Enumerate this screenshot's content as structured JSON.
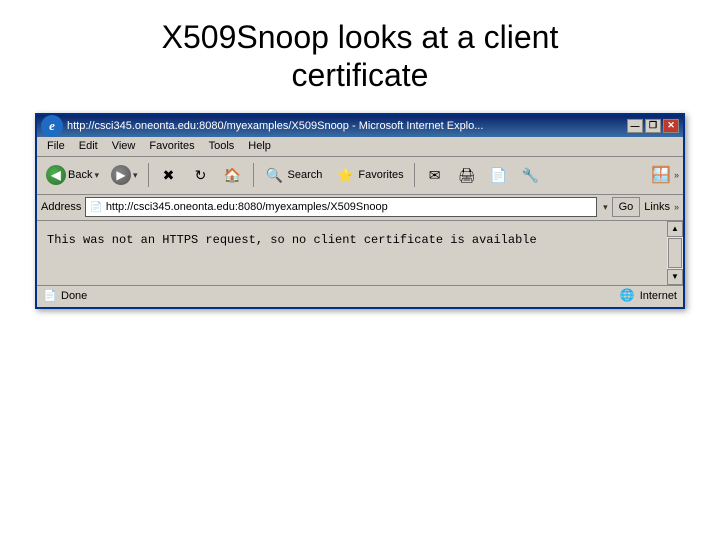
{
  "slide": {
    "title_line1": "X509Snoop looks at a client",
    "title_line2": "certificate"
  },
  "browser": {
    "title_bar": {
      "text": "http://csci345.oneonta.edu:8080/myexamples/X509Snoop - Microsoft Internet Explo...",
      "buttons": {
        "minimize": "—",
        "restore": "❐",
        "close": "✕"
      }
    },
    "menu": {
      "items": [
        "File",
        "Edit",
        "View",
        "Favorites",
        "Tools",
        "Help"
      ]
    },
    "toolbar": {
      "back_label": "Back",
      "search_label": "Search",
      "favorites_label": "Favorites"
    },
    "address_bar": {
      "label": "Address",
      "url": "http://csci345.oneonta.edu:8080/myexamples/X509Snoop",
      "go_label": "Go",
      "links_label": "Links"
    },
    "content": {
      "text": "This was not an HTTPS request, so no client certificate is available"
    },
    "status_bar": {
      "status": "Done",
      "zone": "Internet"
    }
  }
}
